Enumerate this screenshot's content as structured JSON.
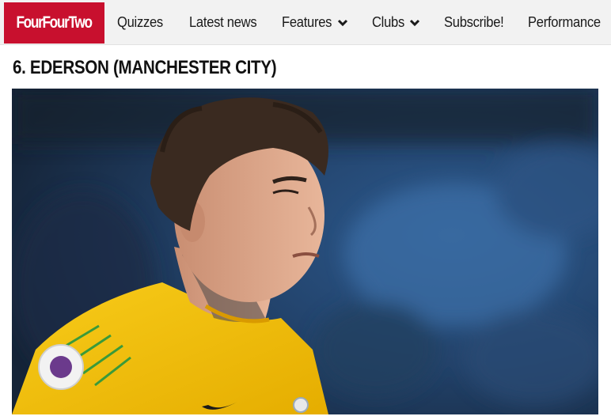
{
  "logo": {
    "text": "FourFourTwo",
    "color": "#c8102e"
  },
  "nav": {
    "items": [
      {
        "label": "Quizzes",
        "dropdown": false
      },
      {
        "label": "Latest news",
        "dropdown": false
      },
      {
        "label": "Features",
        "dropdown": true
      },
      {
        "label": "Clubs",
        "dropdown": true
      },
      {
        "label": "Subscribe!",
        "dropdown": false
      },
      {
        "label": "Performance",
        "dropdown": false
      }
    ]
  },
  "article": {
    "heading": "6. EDERSON (MANCHESTER CITY)",
    "image": {
      "icon": "photo-goalkeeper-yellow-kit"
    }
  },
  "colors": {
    "brand": "#c8102e",
    "nav_bg": "#f2f2f2",
    "kit_yellow": "#f5c400"
  }
}
